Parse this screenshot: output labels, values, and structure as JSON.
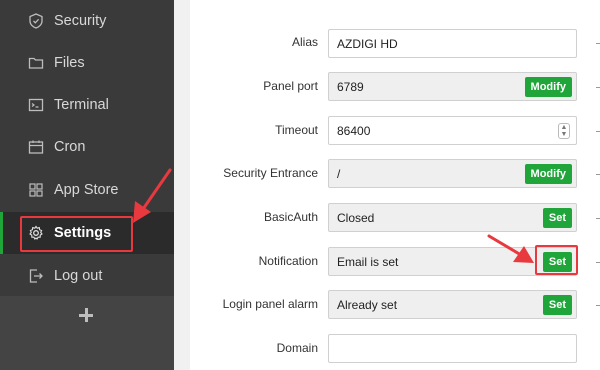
{
  "sidebar": {
    "items": [
      {
        "label": "Security",
        "icon": "shield-icon"
      },
      {
        "label": "Files",
        "icon": "folder-icon"
      },
      {
        "label": "Terminal",
        "icon": "terminal-icon"
      },
      {
        "label": "Cron",
        "icon": "calendar-icon"
      },
      {
        "label": "App Store",
        "icon": "grid-icon"
      },
      {
        "label": "Settings",
        "icon": "gear-icon",
        "active": true
      },
      {
        "label": "Log out",
        "icon": "logout-icon"
      }
    ],
    "add_icon": "plus-icon"
  },
  "settings": {
    "alias": {
      "label": "Alias",
      "value": "AZDIGI HD"
    },
    "panel_port": {
      "label": "Panel port",
      "value": "6789",
      "button": "Modify"
    },
    "timeout": {
      "label": "Timeout",
      "value": "86400"
    },
    "security_entrance": {
      "label": "Security Entrance",
      "value": "/",
      "button": "Modify"
    },
    "basic_auth": {
      "label": "BasicAuth",
      "value": "Closed",
      "button": "Set"
    },
    "notification": {
      "label": "Notification",
      "value": "Email is set",
      "button": "Set"
    },
    "login_alarm": {
      "label": "Login panel alarm",
      "value": "Already set",
      "button": "Set"
    },
    "domain": {
      "label": "Domain",
      "value": ""
    }
  },
  "colors": {
    "sidebar_bg": "#3a3a3a",
    "accent_green": "#20a53a",
    "annotation_red": "#e8393f"
  }
}
